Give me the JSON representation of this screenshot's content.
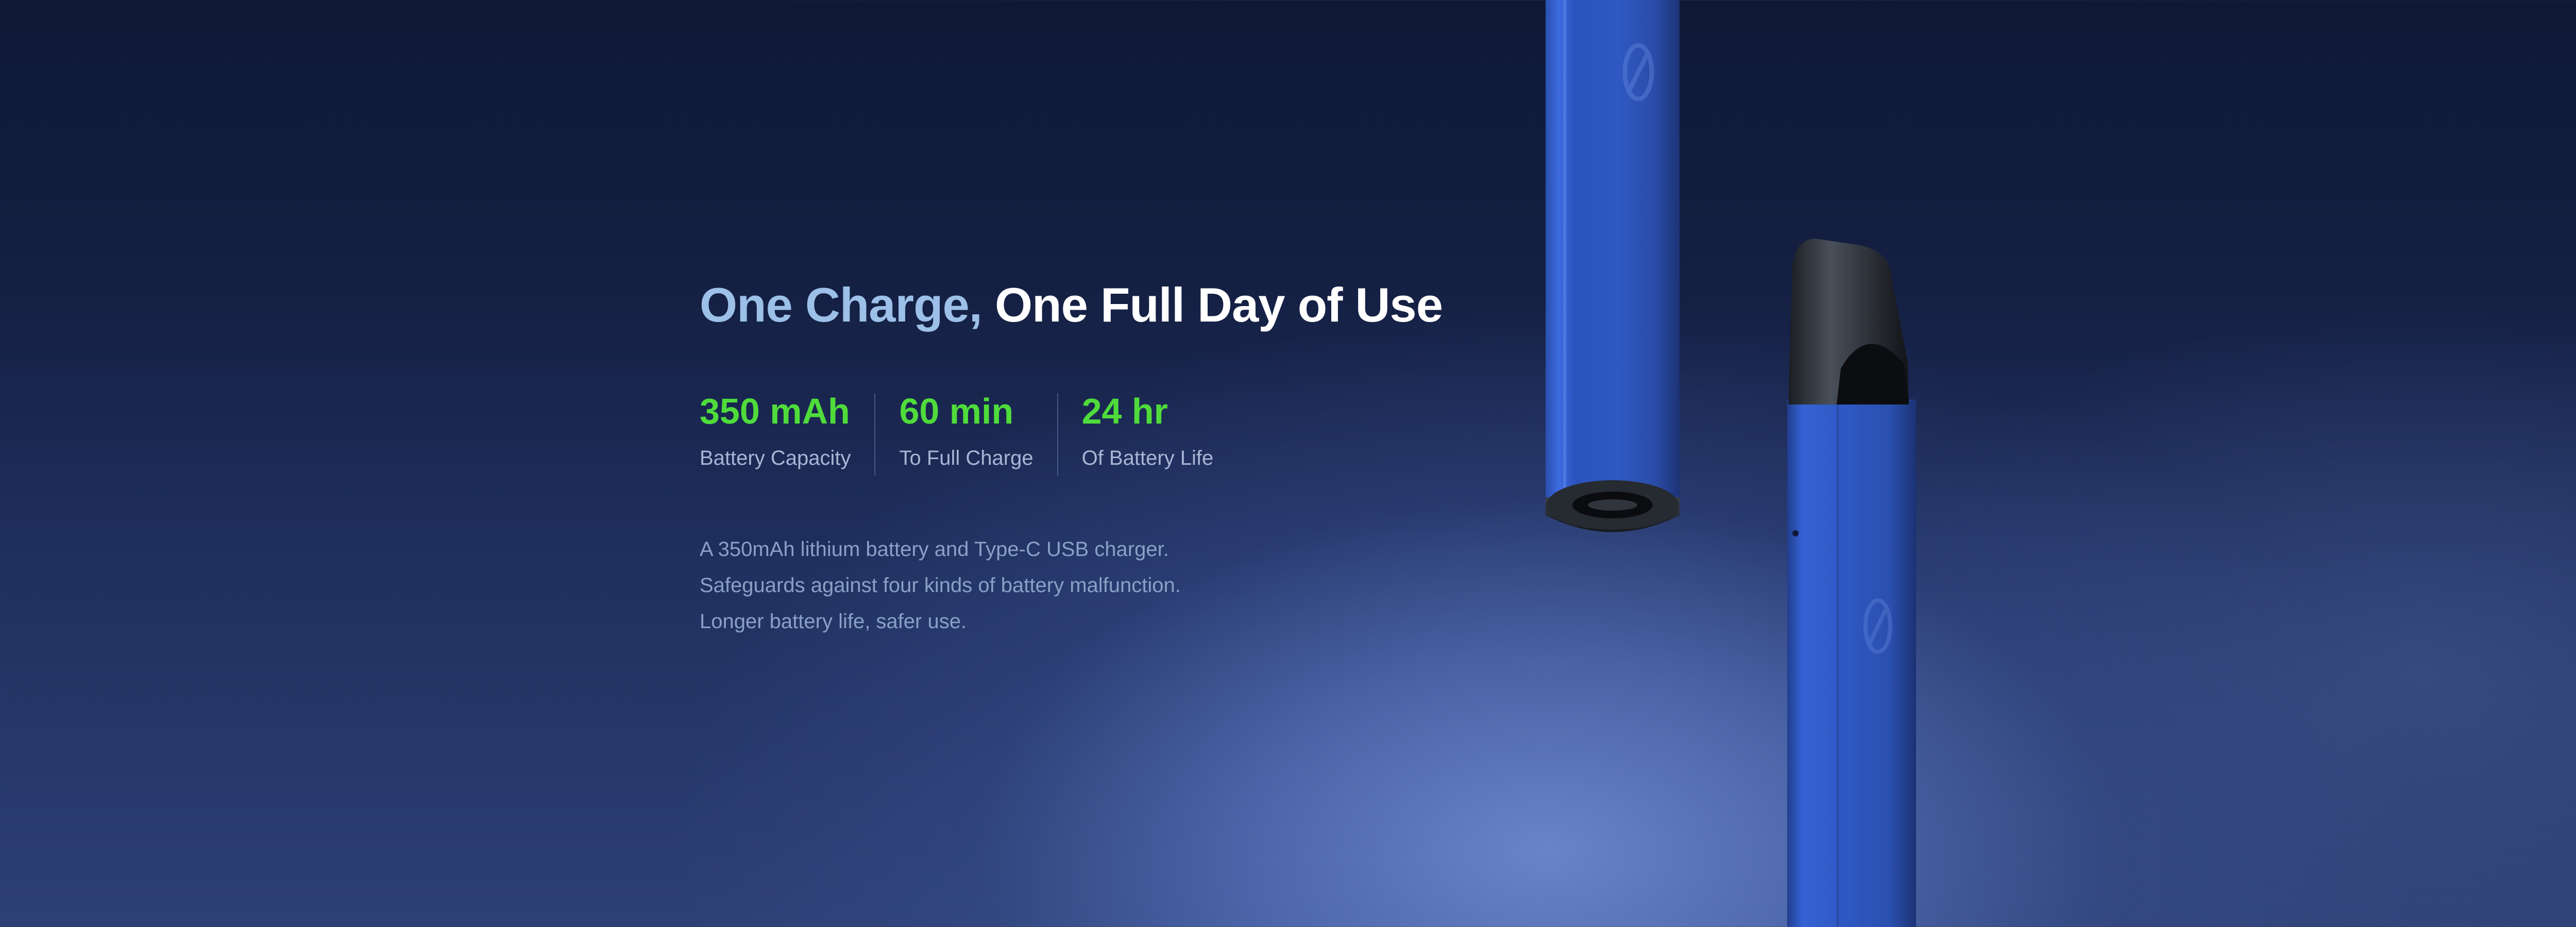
{
  "hero": {
    "title_part1": "One Charge,",
    "title_part2": "One Full Day of Use",
    "stats": [
      {
        "value": "350 mAh",
        "label": "Battery Capacity"
      },
      {
        "value": "60 min",
        "label": "To Full Charge"
      },
      {
        "value": "24 hr",
        "label": "Of Battery Life"
      }
    ],
    "description": [
      "A 350mAh lithium battery and Type-C USB charger.",
      "Safeguards against four kinds of battery malfunction.",
      "Longer battery life, safer use."
    ]
  },
  "colors": {
    "accent_green": "#4fdc3b",
    "title_light_blue": "#9cc0e8",
    "device_blue": "#2f59c4"
  },
  "icons": [
    "usb-c-port-icon",
    "brand-logo-icon"
  ]
}
